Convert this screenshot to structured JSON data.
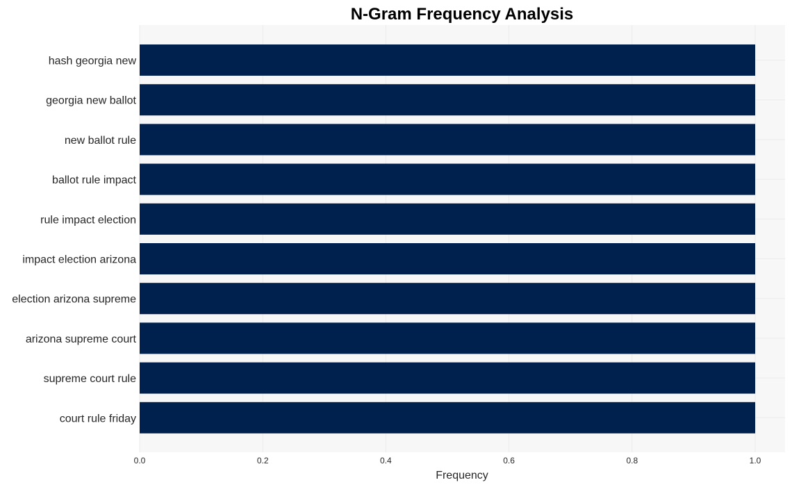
{
  "chart_data": {
    "type": "bar",
    "orientation": "horizontal",
    "title": "N-Gram Frequency Analysis",
    "xlabel": "Frequency",
    "ylabel": "",
    "xlim": [
      0,
      1.05
    ],
    "xticks": [
      "0.0",
      "0.2",
      "0.4",
      "0.6",
      "0.8",
      "1.0"
    ],
    "xtick_values": [
      0,
      0.2,
      0.4,
      0.6,
      0.8,
      1.0
    ],
    "grid": true,
    "bar_color": "#00204e",
    "background_color": "#f7f7f7",
    "categories": [
      "hash georgia new",
      "georgia new ballot",
      "new ballot rule",
      "ballot rule impact",
      "rule impact election",
      "impact election arizona",
      "election arizona supreme",
      "arizona supreme court",
      "supreme court rule",
      "court rule friday"
    ],
    "values": [
      1,
      1,
      1,
      1,
      1,
      1,
      1,
      1,
      1,
      1
    ]
  }
}
